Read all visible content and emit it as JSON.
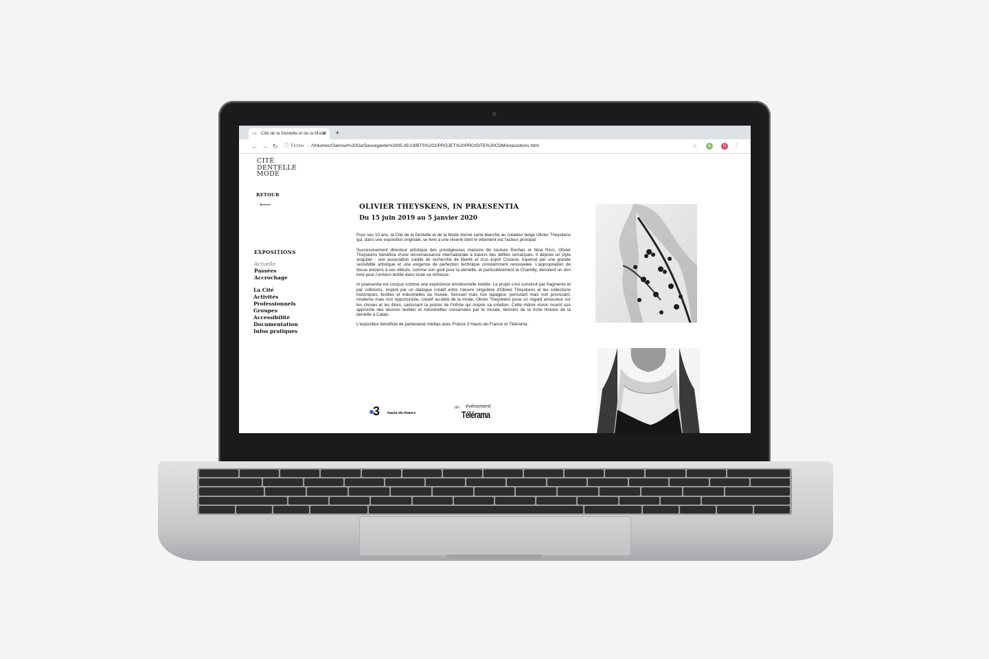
{
  "browser": {
    "tab_title": "Cité de la Dentelle et de la Mode",
    "tab_favicon": "La",
    "omnibox_scheme": "Fichier",
    "url": "/Volumes/Clarisse%20Ga/Sauvegarde%2005.09.19/BTS%202/PROJET%20PRO/SITE%20CDM/expositions.html",
    "profile_initial": "G",
    "icons": [
      "back-arrow-icon",
      "forward-arrow-icon",
      "reload-icon",
      "info-icon",
      "star-icon",
      "extension-icon",
      "profile-avatar",
      "kebab-menu-icon"
    ]
  },
  "site": {
    "logo_lines": [
      "CITÉ",
      "DENTELLE",
      "MODE"
    ],
    "retour": "RETOUR",
    "section_title": "EXPOSITIONS",
    "subnav": [
      "Actuelle",
      "Passées",
      "Accrochage"
    ],
    "mainnav": [
      "La Cité",
      "Activités",
      "Professionnels",
      "Groupes",
      "Accessibilité",
      "Documentation",
      "Infos pratiques"
    ]
  },
  "exhibition": {
    "title": "OLIVIER THEYSKENS, IN PRAESENTIA",
    "dates": "Du 15 juin 2019 au 5 janvier 2020",
    "paragraphs": [
      "Pour ses 10 ans, la Cité de la Dentelle et de la Mode donne carte-blanche au créateur belge Olivier Theyskens qui, dans une exposition originale, se livre à une rêverie dont le vêtement est l'acteur principal.",
      "Successivement directeur artistique des prestigieuses maisons de couture Rochas et Nina Ricci, Olivier Theyskens bénéficie d'une reconnaissance internationale à travers des défilés remarqués. Il déploie un style singulier : une association subtile de recherche de liberté et d'un esprit Couture, traversé par une grande sensibilité artistique et une exigence de perfection technique constamment renouvelée. L'appropriation de tissus anciens à ses débuts, comme son goût pour la dentelle, et particulièrement la Chantilly, dénotent un don inné pour l'univers textile dans toute sa richesse.",
      "In praesentia est conçue comme une expérience émotionnelle inédite. Le projet s'est construit par fragments et par collisions, inspiré par un dialogue créatif entre l'œuvre singulière d'Olivier Theyskens et les collections historiques, textiles et industrielles du musée. Sensuel mais non tapageur, percutant mais non provocant, moderne mais non opportuniste, créatif au-delà de la mode, Olivier Theyskens pose un regard amoureux sur les choses et les êtres, saisissant la poésie de l'infime qui inspire sa création. Cette même vision nourrit son approche des œuvres textiles et industrielles conservées par le musée, témoins de la riche histoire de la dentelle à Calais.",
      "L'exposition bénéficie de partenariat médias avec France 3 Hauts-de-France et Télérama."
    ],
    "partners": {
      "france3_number": "3",
      "france3_label": "hauts-de-france",
      "telerama_prefix": "un",
      "telerama_event": "événement",
      "telerama_name": "Télérama"
    }
  },
  "colors": {
    "france3_blue": "#3a6dc5",
    "page_bg": "#ffffff",
    "laptop_bezel": "#1b1b1c",
    "laptop_body": "#c6c6c9"
  }
}
